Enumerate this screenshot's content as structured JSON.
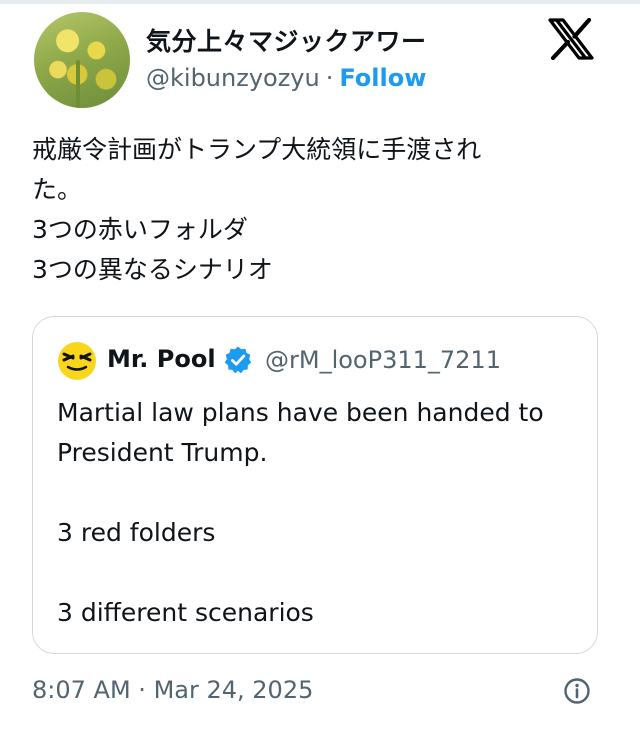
{
  "author": {
    "display_name": "気分上々マジックアワー",
    "handle": "@kibunzyozyu",
    "separator": "·",
    "follow_label": "Follow"
  },
  "brand": {
    "icon": "x-logo-icon",
    "color": "#000000"
  },
  "tweet": {
    "lines": [
      "戒厳令計画がトランプ大統領に手渡され",
      "た。",
      "3つの赤いフォルダ",
      "3つの異なるシナリオ"
    ]
  },
  "quoted_tweet": {
    "display_name": "Mr. Pool",
    "verified": true,
    "handle": "@rM_looP311_7211",
    "lines": [
      "Martial law plans have been handed to",
      "President Trump.",
      "",
      "3 red folders",
      "",
      "3 different scenarios"
    ]
  },
  "footer": {
    "time": "8:07 AM",
    "separator": "·",
    "date": "Mar 24, 2025",
    "info_icon": "info-icon"
  },
  "colors": {
    "link": "#1d9bf0",
    "secondary_text": "#536471",
    "border": "#cfd9de",
    "verified": "#1d9bf0"
  }
}
